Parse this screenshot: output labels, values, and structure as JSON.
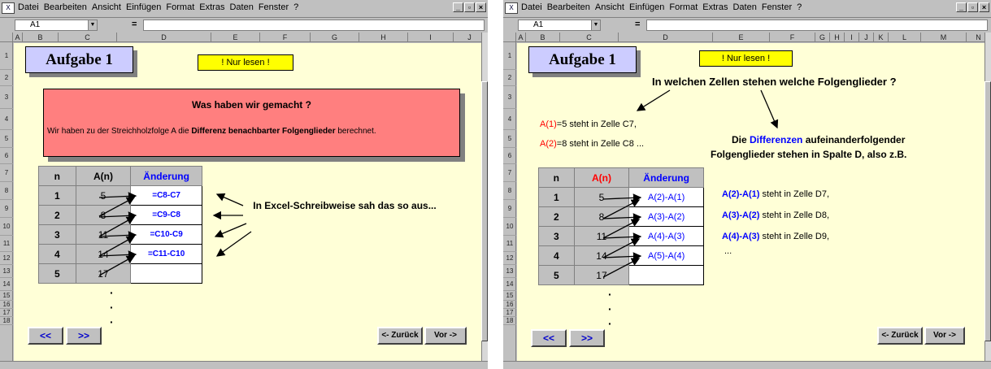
{
  "menu": [
    "Datei",
    "Bearbeiten",
    "Ansicht",
    "Einfügen",
    "Format",
    "Extras",
    "Daten",
    "Fenster",
    "?"
  ],
  "window_controls": [
    "_",
    "ȳ",
    "×"
  ],
  "name_box": "A1",
  "formula_eq": "=",
  "left": {
    "columns": [
      "A",
      "B",
      "C",
      "D",
      "E",
      "F",
      "G",
      "H",
      "I",
      "J"
    ],
    "rows": [
      "1",
      "2",
      "3",
      "4",
      "5",
      "6",
      "7",
      "8",
      "9",
      "10",
      "11",
      "12",
      "13",
      "14",
      "15",
      "16",
      "17",
      "18"
    ],
    "title": "Aufgabe 1",
    "nur_lesen": "! Nur lesen !",
    "pink_heading": "Was haben wir gemacht ?",
    "pink_text_pre": "Wir haben zu der Streichholzfolge A die ",
    "pink_text_bold": "Differenz benachbarter Folgenglieder",
    "pink_text_post": " berechnet.",
    "table_header": [
      "n",
      "A(n)",
      "Änderung"
    ],
    "table_rows": [
      {
        "n": "1",
        "a": "5",
        "change": "=C8-C7"
      },
      {
        "n": "2",
        "a": "8",
        "change": "=C9-C8"
      },
      {
        "n": "3",
        "a": "11",
        "change": "=C10-C9"
      },
      {
        "n": "4",
        "a": "14",
        "change": "=C11-C10"
      },
      {
        "n": "5",
        "a": "17",
        "change": ""
      }
    ],
    "excel_note": "In Excel-Schreibweise sah das so aus...",
    "dots": "·\n·\n·",
    "btn_back": "<<",
    "btn_fwd": ">>",
    "btn_zurueck": "<- Zurück",
    "btn_vor": "Vor ->"
  },
  "right": {
    "columns": [
      "A",
      "B",
      "C",
      "D",
      "E",
      "F",
      "G",
      "H",
      "I",
      "J",
      "K",
      "L",
      "M",
      "N"
    ],
    "rows": [
      "1",
      "2",
      "3",
      "4",
      "5",
      "6",
      "7",
      "8",
      "9",
      "10",
      "11",
      "12",
      "13",
      "14",
      "15",
      "16",
      "17",
      "18"
    ],
    "title": "Aufgabe 1",
    "nur_lesen": "! Nur lesen !",
    "question": "In welchen Zellen stehen welche Folgenglieder ?",
    "a1_label": "A(1)",
    "a1_text": "=5 steht in Zelle C7,",
    "a2_label": "A(2)",
    "a2_text": "=8 steht in Zelle C8 ...",
    "diff_line1_pre": "Die ",
    "diff_line1_blue": "Differenzen",
    "diff_line1_post": " aufeinanderfolgender",
    "diff_line2": "Folgenglieder stehen in Spalte D, also z.B.",
    "table_header": [
      "n",
      "A(n)",
      "Änderung"
    ],
    "table_rows": [
      {
        "n": "1",
        "a": "5",
        "change": "A(2)-A(1)"
      },
      {
        "n": "2",
        "a": "8",
        "change": "A(3)-A(2)"
      },
      {
        "n": "3",
        "a": "11",
        "change": "A(4)-A(3)"
      },
      {
        "n": "4",
        "a": "14",
        "change": "A(5)-A(4)"
      },
      {
        "n": "5",
        "a": "17",
        "change": ""
      }
    ],
    "examples": [
      {
        "expr": "A(2)-A(1)",
        "text": " steht in Zelle D7,"
      },
      {
        "expr": "A(3)-A(2)",
        "text": " steht in Zelle D8,"
      },
      {
        "expr": "A(4)-A(3)",
        "text": " steht in Zelle D9,"
      }
    ],
    "ellipsis": "...",
    "btn_back": "<<",
    "btn_fwd": ">>",
    "btn_zurueck": "<- Zurück",
    "btn_vor": "Vor ->"
  }
}
